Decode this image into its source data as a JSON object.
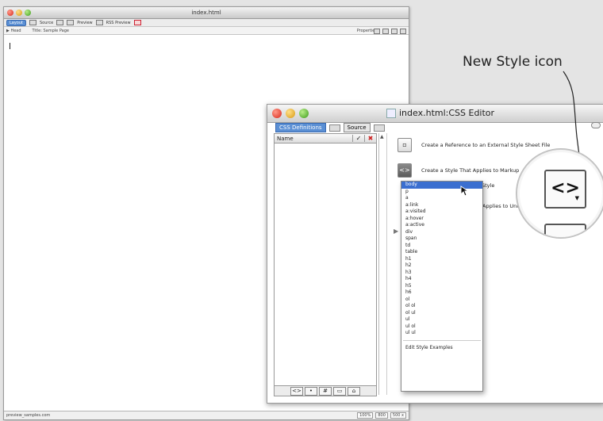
{
  "doc_window": {
    "title": "index.html",
    "tabs": [
      "Layout",
      "Source",
      "Preview",
      "RSS Preview"
    ],
    "toolbar": {
      "head": "Head",
      "title_field": "Title: Sample Page",
      "properties": "Properties"
    },
    "status_left": "preview_samples.com",
    "status_right": [
      "100%",
      "800",
      "500 x"
    ]
  },
  "css_editor": {
    "title": "index.html:CSS Editor",
    "tabs": [
      "CSS Definitions",
      "Source"
    ],
    "list_header": {
      "name": "Name",
      "check": "✓",
      "remove": "✖"
    },
    "footer_buttons": [
      "<>",
      "•",
      "#",
      "▭",
      "⌂"
    ],
    "options": [
      {
        "icon": "link-icon",
        "label": "Create a Reference to an External Style Sheet File"
      },
      {
        "icon": "new-style-icon",
        "label": "Create a Style That Applies to Markup"
      },
      {
        "icon": "",
        "label": "Style"
      },
      {
        "icon": "",
        "label": "Applies to Unique"
      }
    ],
    "menu": {
      "items": [
        "body",
        "p",
        "a",
        "a:link",
        "a:visited",
        "a:hover",
        "a:active",
        "div",
        "span",
        "td",
        "table",
        "h1",
        "h2",
        "h3",
        "h4",
        "h5",
        "h6",
        "ol",
        "ol ol",
        "ol ul",
        "ul",
        "ul ol",
        "ul ul"
      ],
      "selected": "body",
      "edit_label": "Edit Style Examples"
    }
  },
  "callout": {
    "label": "New Style icon",
    "icon_glyph": "<>"
  }
}
